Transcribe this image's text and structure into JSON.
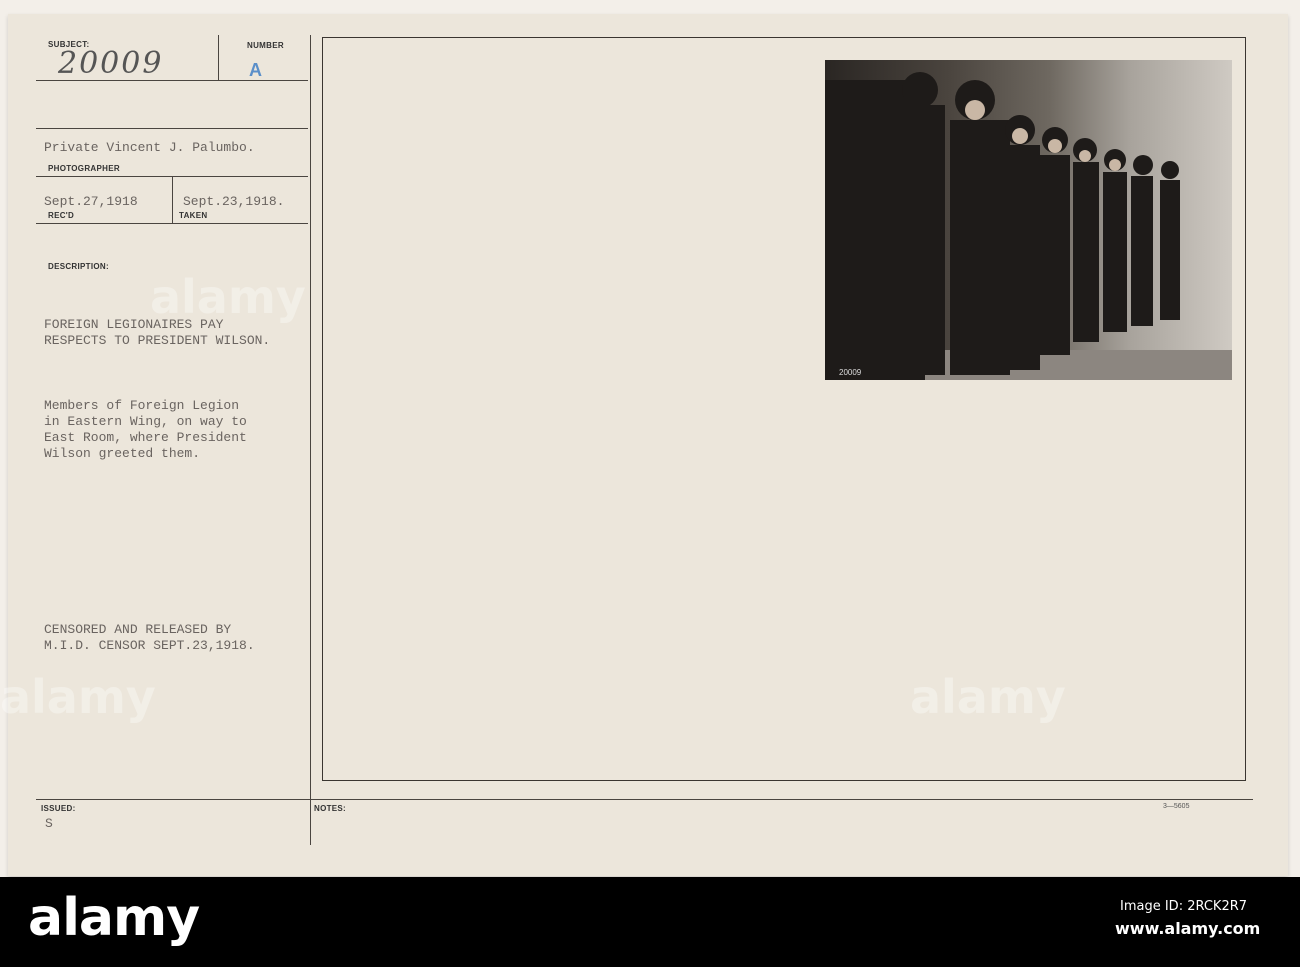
{
  "card": {
    "subject_label": "SUBJECT:",
    "subject_value": "20009",
    "number_label": "NUMBER",
    "number_value": "A",
    "photographer_value": "Private Vincent J. Palumbo.",
    "photographer_label": "PHOTOGRAPHER",
    "received_value": "Sept.27,1918",
    "received_label": "REC'D",
    "taken_value": "Sept.23,1918.",
    "taken_label": "TAKEN",
    "description_label": "DESCRIPTION:",
    "title_text": "FOREIGN LEGIONAIRES PAY\nRESPECTS TO PRESIDENT WILSON.",
    "description_text": "Members of Foreign Legion\nin Eastern Wing, on way to\nEast Room, where President\nWilson greeted them.",
    "censor_text": "CENSORED AND RELEASED BY\nM.I.D. CENSOR SEPT.23,1918.",
    "issued_label": "ISSUED:",
    "issued_value": "S",
    "notes_label": "NOTES:",
    "form_number": "3—5605",
    "photo_caption": "20009"
  },
  "footer": {
    "logo": "alamy",
    "image_id": "Image ID: 2RCK2R7",
    "site": "www.alamy.com"
  }
}
